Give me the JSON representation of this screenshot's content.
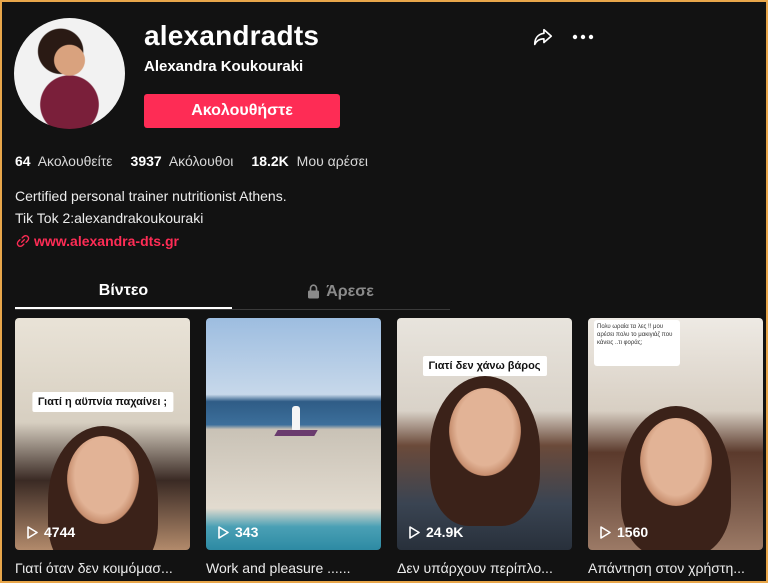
{
  "profile": {
    "username": "alexandradts",
    "full_name": "Alexandra Koukouraki",
    "follow_label": "Ακολουθήστε",
    "stats": [
      {
        "value": "64",
        "label": "Ακολουθείτε"
      },
      {
        "value": "3937",
        "label": "Ακόλουθοι"
      },
      {
        "value": "18.2K",
        "label": "Μου αρέσει"
      }
    ],
    "bio_lines": [
      "Certified personal trainer nutritionist Athens.",
      "Tik Tok 2:alexandrakoukouraki"
    ],
    "link": "www.alexandra-dts.gr"
  },
  "tabs": [
    {
      "label": "Βίντεο",
      "active": true
    },
    {
      "label": "Άρεσε",
      "active": false,
      "icon": "lock-icon"
    }
  ],
  "videos": [
    {
      "views": "4744",
      "title": "Γιατί όταν δεν κοιμόμασ...",
      "overlay_text": "Γιατί η αϋπνία παχαίνει ;"
    },
    {
      "views": "343",
      "title": "Work and pleasure ......"
    },
    {
      "views": "24.9K",
      "title": "Δεν υπάρχουν περίπλο...",
      "overlay_text": "Γιατί δεν χάνω βάρος"
    },
    {
      "views": "1560",
      "title": "Απάντηση στον χρήστη...",
      "overlay_text": "Πολυ ωραία τα λες !! μου αρέσει πολυ το μακιγιάζ που κάνεις ..τι φοράς;"
    }
  ],
  "colors": {
    "accent": "#fe2c55",
    "background": "#121212"
  },
  "icons": [
    "share-icon",
    "more-icon",
    "link-icon",
    "lock-icon",
    "play-icon"
  ]
}
